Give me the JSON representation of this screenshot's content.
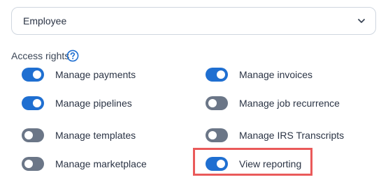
{
  "role_select": {
    "value": "Employee"
  },
  "access_rights": {
    "label": "Access rights",
    "help_icon": "question-circle-icon"
  },
  "permissions": [
    {
      "label": "Manage payments",
      "enabled": true
    },
    {
      "label": "Manage invoices",
      "enabled": true
    },
    {
      "label": "Manage pipelines",
      "enabled": true
    },
    {
      "label": "Manage job recurrence",
      "enabled": false
    },
    {
      "label": "Manage templates",
      "enabled": false
    },
    {
      "label": "Manage IRS Transcripts",
      "enabled": false
    },
    {
      "label": "Manage marketplace",
      "enabled": false
    },
    {
      "label": "View reporting",
      "enabled": true
    }
  ],
  "colors": {
    "toggle_on": "#1f6fd1",
    "toggle_off": "#6b7687",
    "highlight": "#ea5a5a"
  }
}
